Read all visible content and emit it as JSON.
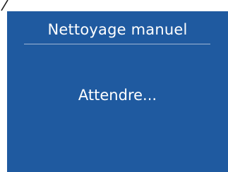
{
  "screen": {
    "title": "Nettoyage manuel",
    "message": "Attendre..."
  },
  "colors": {
    "panel_background": "#1f5aa0",
    "text": "#ffffff",
    "divider": "#9fb6d6"
  }
}
